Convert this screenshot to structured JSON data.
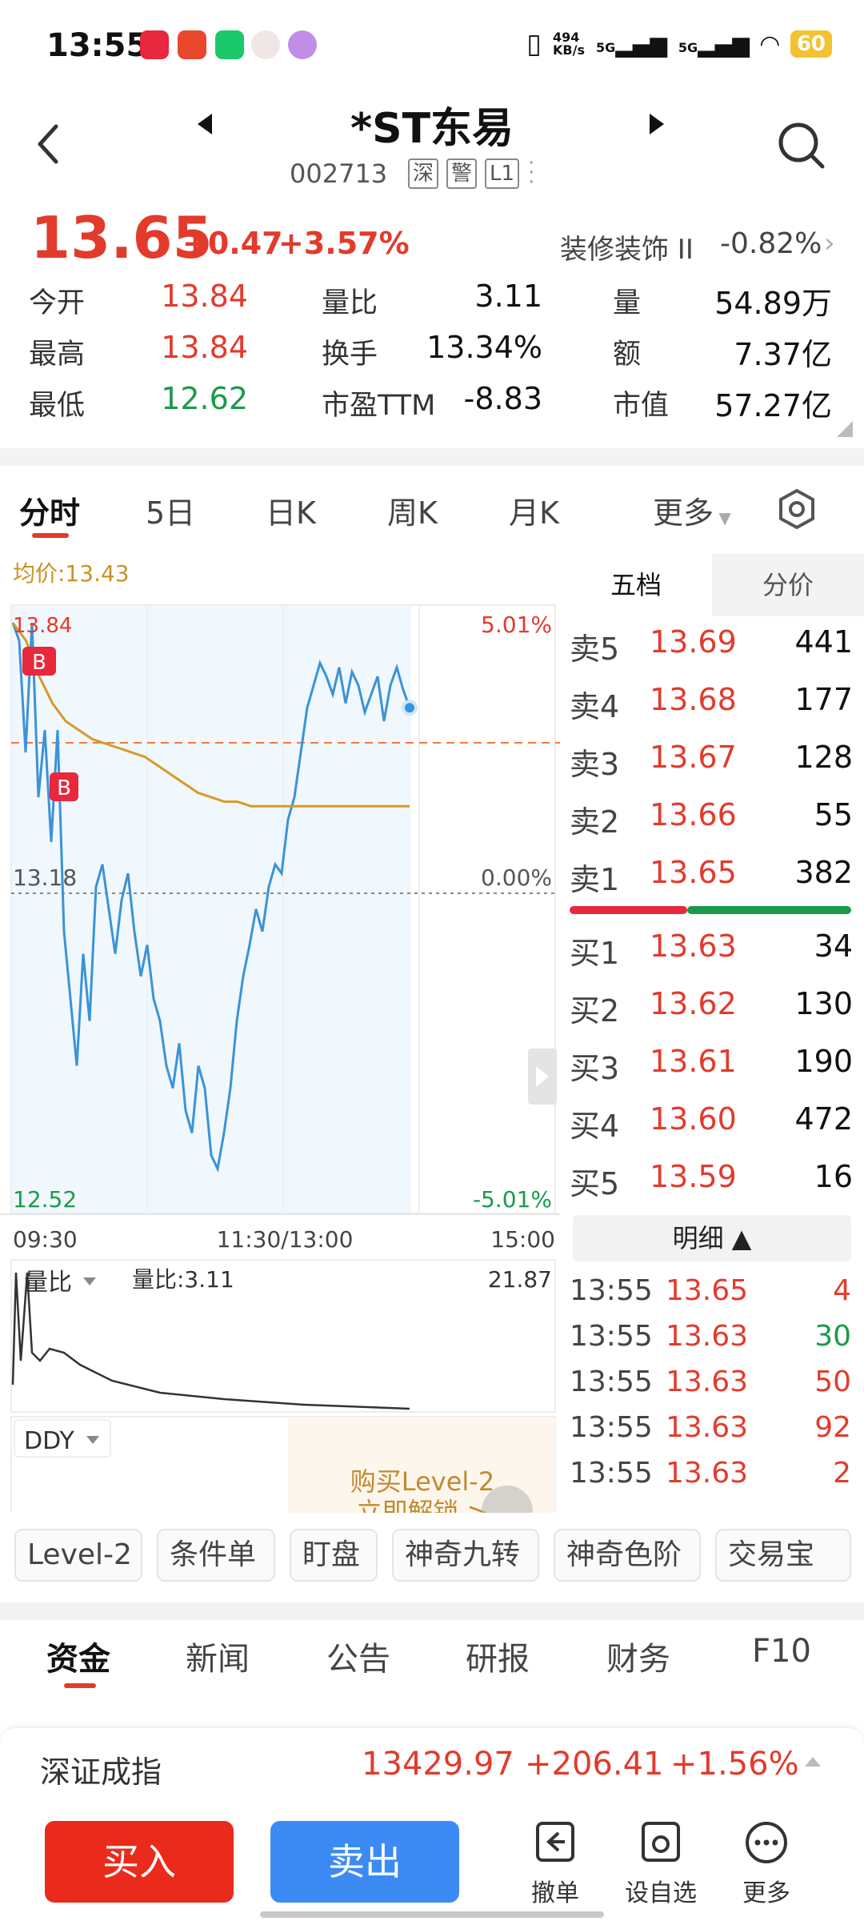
{
  "status_bar": {
    "time": "13:55",
    "net_speed_value": "494",
    "net_speed_unit": "KB/s",
    "sim1": "5G",
    "sim2": "5G",
    "battery": "60"
  },
  "header": {
    "title": "*ST东易",
    "code": "002713",
    "tags": [
      "深",
      "警",
      "L1"
    ]
  },
  "quote": {
    "price": "13.65",
    "change": "+0.47",
    "change_pct": "+3.57%",
    "sector": "装修装饰 II",
    "sector_pct": "-0.82%",
    "stats": [
      {
        "label": "今开",
        "value": "13.84"
      },
      {
        "label": "量比",
        "value": "3.11"
      },
      {
        "label": "量",
        "value": "54.89万"
      },
      {
        "label": "最高",
        "value": "13.84"
      },
      {
        "label": "换手",
        "value": "13.34%"
      },
      {
        "label": "额",
        "value": "7.37亿"
      },
      {
        "label": "最低",
        "value": "12.62"
      },
      {
        "label": "市盈TTM",
        "value": "-8.83"
      },
      {
        "label": "市值",
        "value": "57.27亿"
      }
    ]
  },
  "chart_tabs": [
    "分时",
    "5日",
    "日K",
    "周K",
    "月K",
    "更多"
  ],
  "chart": {
    "avg_label": "均价:13.43",
    "top_price": "13.84",
    "top_pct": "5.01%",
    "mid_price": "13.18",
    "mid_pct": "0.00%",
    "bottom_price": "12.52",
    "bottom_pct": "-5.01%",
    "time_labels": [
      "09:30",
      "11:30/13:00",
      "15:00"
    ],
    "marker": "B",
    "vol_selector": "量比",
    "vol_ratio_label": "量比:3.11",
    "vol_max": "21.87",
    "ddy_selector": "DDY",
    "promo_line1": "购买Level-2",
    "promo_line2": "立即解锁 >",
    "colors": {
      "price_line": "#3a93d8",
      "avg_line": "#d79a28",
      "up": "#e23b2c",
      "down": "#1a9b4b"
    }
  },
  "chart_data": {
    "type": "line",
    "title": "",
    "xlabel": "",
    "ylabel": "",
    "x_ticks": [
      "09:30",
      "11:30/13:00",
      "15:00"
    ],
    "ylim": [
      12.52,
      13.84
    ],
    "series": [
      {
        "name": "",
        "values": [
          13.84,
          13.8,
          13.55,
          13.84,
          13.45,
          13.6,
          13.35,
          13.6,
          13.15,
          13.0,
          12.85,
          13.1,
          12.95,
          13.25,
          13.3,
          13.2,
          13.1,
          13.22,
          13.28,
          13.15,
          13.05,
          13.12,
          13.0,
          12.95,
          12.85,
          12.8,
          12.9,
          12.75,
          12.7,
          12.85,
          12.8,
          12.65,
          12.62,
          12.7,
          12.8,
          12.95,
          13.05,
          13.12,
          13.2,
          13.15,
          13.25,
          13.3,
          13.28,
          13.4,
          13.45,
          13.55,
          13.65,
          13.7,
          13.75,
          13.72,
          13.68,
          13.74,
          13.66,
          13.73,
          13.7,
          13.64,
          13.68,
          13.72,
          13.62,
          13.7,
          13.74,
          13.69,
          13.65
        ]
      },
      {
        "name": "均价",
        "values": [
          13.84,
          13.8,
          13.72,
          13.66,
          13.62,
          13.6,
          13.58,
          13.57,
          13.56,
          13.55,
          13.54,
          13.52,
          13.5,
          13.48,
          13.46,
          13.45,
          13.44,
          13.44,
          13.43,
          13.43,
          13.43,
          13.43,
          13.43,
          13.43,
          13.43,
          13.43,
          13.43,
          13.43,
          13.43,
          13.43,
          13.43
        ]
      }
    ]
  },
  "order_book": {
    "tabs": [
      "五档",
      "分价"
    ],
    "asks": [
      {
        "label": "卖5",
        "price": "13.69",
        "vol": "441"
      },
      {
        "label": "卖4",
        "price": "13.68",
        "vol": "177"
      },
      {
        "label": "卖3",
        "price": "13.67",
        "vol": "128"
      },
      {
        "label": "卖2",
        "price": "13.66",
        "vol": "55"
      },
      {
        "label": "卖1",
        "price": "13.65",
        "vol": "382"
      }
    ],
    "bids": [
      {
        "label": "买1",
        "price": "13.63",
        "vol": "34"
      },
      {
        "label": "买2",
        "price": "13.62",
        "vol": "130"
      },
      {
        "label": "买3",
        "price": "13.61",
        "vol": "190"
      },
      {
        "label": "买4",
        "price": "13.60",
        "vol": "472"
      },
      {
        "label": "买5",
        "price": "13.59",
        "vol": "16"
      }
    ],
    "detail_header": "明细 ▲",
    "ticks": [
      {
        "time": "13:55",
        "price": "13.65",
        "vol": "4",
        "dir": "up"
      },
      {
        "time": "13:55",
        "price": "13.63",
        "vol": "30",
        "dir": "down"
      },
      {
        "time": "13:55",
        "price": "13.63",
        "vol": "50",
        "dir": "up"
      },
      {
        "time": "13:55",
        "price": "13.63",
        "vol": "92",
        "dir": "up"
      },
      {
        "time": "13:55",
        "price": "13.63",
        "vol": "2",
        "dir": "up"
      }
    ]
  },
  "feature_chips": [
    "Level-2",
    "条件单",
    "盯盘",
    "神奇九转",
    "神奇色阶",
    "交易宝"
  ],
  "bottom_tabs": [
    "资金",
    "新闻",
    "公告",
    "研报",
    "财务",
    "F10"
  ],
  "index_bar": {
    "name": "深证成指",
    "value": "13429.97",
    "change": "+206.41",
    "pct": "+1.56%"
  },
  "actions": {
    "buy": "买入",
    "sell": "卖出",
    "cancel": "撤单",
    "watchlist": "设自选",
    "more": "更多"
  }
}
